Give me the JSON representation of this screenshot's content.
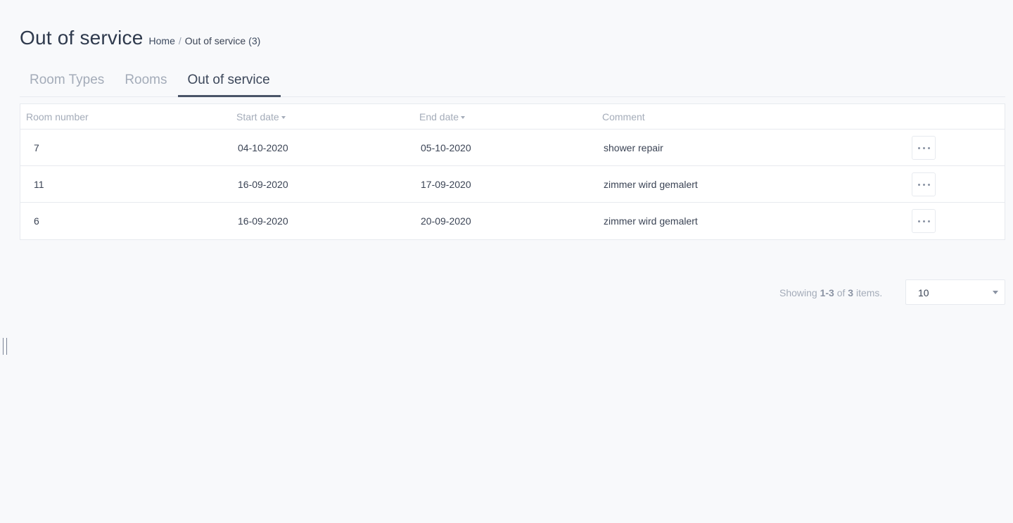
{
  "header": {
    "title": "Out of service",
    "breadcrumb": {
      "home": "Home",
      "separator": "/",
      "current": "Out of service",
      "count": "(3)"
    }
  },
  "tabs": [
    {
      "label": "Room Types",
      "active": false
    },
    {
      "label": "Rooms",
      "active": false
    },
    {
      "label": "Out of service",
      "active": true
    }
  ],
  "table": {
    "columns": {
      "room_number": "Room number",
      "start_date": "Start date",
      "end_date": "End date",
      "comment": "Comment"
    },
    "rows": [
      {
        "room_number": "7",
        "start_date": "04-10-2020",
        "end_date": "05-10-2020",
        "comment": "shower repair"
      },
      {
        "room_number": "11",
        "start_date": "16-09-2020",
        "end_date": "17-09-2020",
        "comment": "zimmer wird gemalert"
      },
      {
        "room_number": "6",
        "start_date": "16-09-2020",
        "end_date": "20-09-2020",
        "comment": "zimmer wird gemalert"
      }
    ]
  },
  "pager": {
    "showing": "Showing",
    "range": "1-3",
    "of": "of",
    "total": "3",
    "items": "items.",
    "page_size": "10"
  },
  "colors": {
    "accent": "#4a5568",
    "muted": "#a4acb9",
    "text": "#3b4455",
    "border": "#e7eaef"
  }
}
